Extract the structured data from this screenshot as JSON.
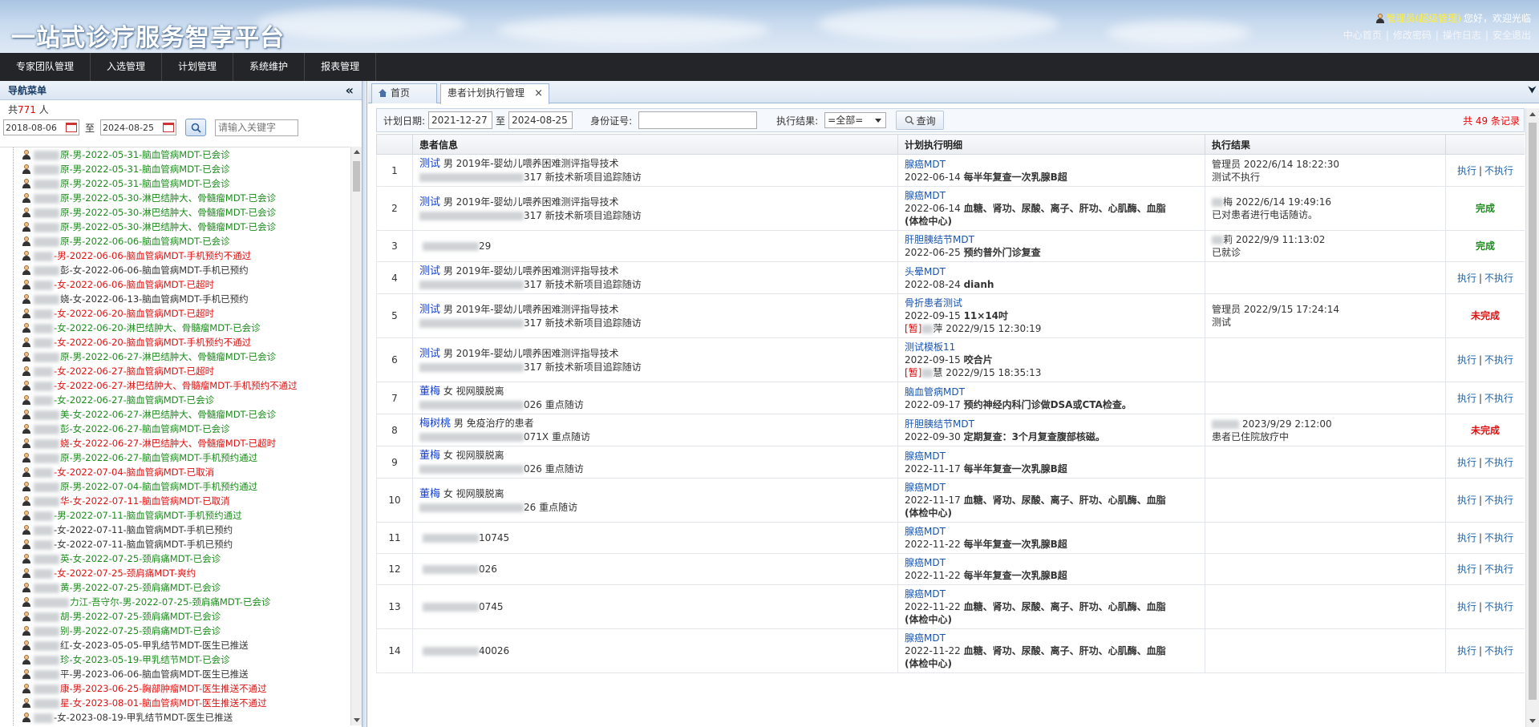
{
  "app": {
    "title": "一站式诊疗服务智享平台",
    "user_role": "管理员(超级管理)",
    "greeting": "您好，欢迎光临",
    "header_links": [
      "中心首页",
      "修改密码",
      "操作日志",
      "安全退出"
    ]
  },
  "topnav": [
    "专家团队管理",
    "入选管理",
    "计划管理",
    "系统维护",
    "报表管理"
  ],
  "sidebar": {
    "title": "导航菜单",
    "collapse_icon": "«",
    "count_prefix": "共",
    "count": "771",
    "count_suffix": "人",
    "date_from": "2018-08-06",
    "date_sep": "至",
    "date_to": "2024-08-25",
    "keyword_placeholder": "请输入关键字",
    "items": [
      {
        "text": "原-男-2022-05-31-脑血管病MDT-已会诊",
        "color": "green",
        "b": "n"
      },
      {
        "text": "原-男-2022-05-31-脑血管病MDT-已会诊",
        "color": "green",
        "b": "n"
      },
      {
        "text": "原-男-2022-05-31-脑血管病MDT-已会诊",
        "color": "green",
        "b": "n"
      },
      {
        "text": "原-男-2022-05-30-淋巴结肿大、骨髓瘤MDT-已会诊",
        "color": "green",
        "b": "n"
      },
      {
        "text": "原-男-2022-05-30-淋巴结肿大、骨髓瘤MDT-已会诊",
        "color": "green",
        "b": "n"
      },
      {
        "text": "原-男-2022-05-30-淋巴结肿大、骨髓瘤MDT-已会诊",
        "color": "green",
        "b": "n"
      },
      {
        "text": "原-男-2022-06-06-脑血管病MDT-已会诊",
        "color": "green",
        "b": "n"
      },
      {
        "text": "-男-2022-06-06-脑血管病MDT-手机预约不通过",
        "color": "red",
        "b": "s"
      },
      {
        "text": "彭-女-2022-06-06-脑血管病MDT-手机已预约",
        "color": "black",
        "b": "n"
      },
      {
        "text": "-女-2022-06-06-脑血管病MDT-已超时",
        "color": "red",
        "b": "s"
      },
      {
        "text": "娆-女-2022-06-13-脑血管病MDT-手机已预约",
        "color": "black",
        "b": "n"
      },
      {
        "text": "-女-2022-06-20-脑血管病MDT-已超时",
        "color": "red",
        "b": "s"
      },
      {
        "text": "-女-2022-06-20-淋巴结肿大、骨髓瘤MDT-已会诊",
        "color": "green",
        "b": "s"
      },
      {
        "text": "-女-2022-06-20-脑血管病MDT-手机预约不通过",
        "color": "red",
        "b": "s"
      },
      {
        "text": "原-男-2022-06-27-淋巴结肿大、骨髓瘤MDT-已会诊",
        "color": "green",
        "b": "n"
      },
      {
        "text": "-女-2022-06-27-脑血管病MDT-已超时",
        "color": "red",
        "b": "s"
      },
      {
        "text": "-女-2022-06-27-淋巴结肿大、骨髓瘤MDT-手机预约不通过",
        "color": "red",
        "b": "s"
      },
      {
        "text": "-女-2022-06-27-脑血管病MDT-已会诊",
        "color": "green",
        "b": "s"
      },
      {
        "text": "美-女-2022-06-27-淋巴结肿大、骨髓瘤MDT-已会诊",
        "color": "green",
        "b": "n"
      },
      {
        "text": "彭-女-2022-06-27-脑血管病MDT-已会诊",
        "color": "green",
        "b": "n"
      },
      {
        "text": "娆-女-2022-06-27-淋巴结肿大、骨髓瘤MDT-已超时",
        "color": "red",
        "b": "n"
      },
      {
        "text": "原-男-2022-06-27-脑血管病MDT-手机预约通过",
        "color": "green",
        "b": "n"
      },
      {
        "text": "-女-2022-07-04-脑血管病MDT-已取消",
        "color": "red",
        "b": "s"
      },
      {
        "text": "原-男-2022-07-04-脑血管病MDT-手机预约通过",
        "color": "green",
        "b": "n"
      },
      {
        "text": "华-女-2022-07-11-脑血管病MDT-已取消",
        "color": "red",
        "b": "n"
      },
      {
        "text": "-男-2022-07-11-脑血管病MDT-手机预约通过",
        "color": "green",
        "b": "s"
      },
      {
        "text": "-女-2022-07-11-脑血管病MDT-手机已预约",
        "color": "black",
        "b": "s"
      },
      {
        "text": "-女-2022-07-11-脑血管病MDT-手机已预约",
        "color": "black",
        "b": "s"
      },
      {
        "text": "英-女-2022-07-25-颈肩痛MDT-已会诊",
        "color": "green",
        "b": "n"
      },
      {
        "text": "-女-2022-07-25-颈肩痛MDT-爽约",
        "color": "red",
        "b": "s"
      },
      {
        "text": "黄-男-2022-07-25-颈肩痛MDT-已会诊",
        "color": "green",
        "b": "n"
      },
      {
        "text": "力江-吾守尔-男-2022-07-25-颈肩痛MDT-已会诊",
        "color": "green",
        "b": "l"
      },
      {
        "text": "胡-男-2022-07-25-颈肩痛MDT-已会诊",
        "color": "green",
        "b": "n"
      },
      {
        "text": "别-男-2022-07-25-颈肩痛MDT-已会诊",
        "color": "green",
        "b": "n"
      },
      {
        "text": "红-女-2023-05-05-甲乳结节MDT-医生已推送",
        "color": "black",
        "b": "n"
      },
      {
        "text": "珍-女-2023-05-19-甲乳结节MDT-已会诊",
        "color": "green",
        "b": "n"
      },
      {
        "text": "平-男-2023-06-06-脑血管病MDT-医生已推送",
        "color": "black",
        "b": "n"
      },
      {
        "text": "康-男-2023-06-25-胸部肿瘤MDT-医生推送不通过",
        "color": "red",
        "b": "n"
      },
      {
        "text": "星-女-2023-08-01-脑血管病MDT-医生推送不通过",
        "color": "red",
        "b": "n"
      },
      {
        "text": "-女-2023-08-19-甲乳结节MDT-医生已推送",
        "color": "black",
        "b": "s"
      }
    ]
  },
  "tabs": {
    "home": "首页",
    "active": "患者计划执行管理",
    "close_icon": "×"
  },
  "filter": {
    "plan_date_label": "计划日期:",
    "date_from": "2021-12-27",
    "date_sep": "至",
    "date_to": "2024-08-25",
    "id_label": "身份证号:",
    "id_value": "",
    "result_label": "执行结果:",
    "result_selected": "=全部=",
    "query_button": "查询",
    "total": "共 49 条记录"
  },
  "table": {
    "headers": [
      "",
      "患者信息",
      "计划执行明细",
      "执行结果",
      ""
    ],
    "action_exec": "执行",
    "action_sep": "|",
    "action_skip": "不执行",
    "rows": [
      {
        "no": "1",
        "name": "测试",
        "info": "男 2019年-婴幼儿喂养困难测评指导技术",
        "id_tail": "317",
        "id_note": "新技术新项目追踪随访",
        "plan_link": "腺癌MDT",
        "plan_date": "2022-06-14",
        "plan_text": "每半年复查一次乳腺B超",
        "plan_extra": "",
        "plan_flag": "",
        "plan_flag_tail": "",
        "result_line1": "管理员 2022/6/14 18:22:30",
        "result_line2": "测试不执行",
        "status": "",
        "has_action": true
      },
      {
        "no": "2",
        "name": "测试",
        "info": "男 2019年-婴幼儿喂养困难测评指导技术",
        "id_tail": "317",
        "id_note": "新技术新项目追踪随访",
        "plan_link": "腺癌MDT",
        "plan_date": "2022-06-14",
        "plan_text": "血糖、肾功、尿酸、离子、肝功、心肌酶、血脂",
        "plan_extra": "(体检中心)",
        "plan_flag": "",
        "plan_flag_tail": "",
        "result_line1": "梅 2022/6/14 19:49:16",
        "result_line2": "已对患者进行电话随访。",
        "status": "完成",
        "has_action": false
      },
      {
        "no": "3",
        "name": "",
        "info": "",
        "id_tail": "29",
        "id_note": "",
        "plan_link": "肝胆胰结节MDT",
        "plan_date": "2022-06-25",
        "plan_text": "预约普外门诊复查",
        "plan_extra": "",
        "plan_flag": "",
        "plan_flag_tail": "",
        "result_line1": "莉 2022/9/9 11:13:02",
        "result_line2": "已就诊",
        "status": "完成",
        "has_action": false
      },
      {
        "no": "4",
        "name": "测试",
        "info": "男 2019年-婴幼儿喂养困难测评指导技术",
        "id_tail": "317",
        "id_note": "新技术新项目追踪随访",
        "plan_link": "头晕MDT",
        "plan_date": "2022-08-24",
        "plan_text": "dianh",
        "plan_extra": "",
        "plan_flag": "",
        "plan_flag_tail": "",
        "result_line1": "",
        "result_line2": "",
        "status": "",
        "has_action": true
      },
      {
        "no": "5",
        "name": "测试",
        "info": "男 2019年-婴幼儿喂养困难测评指导技术",
        "id_tail": "317",
        "id_note": "新技术新项目追踪随访",
        "plan_link": "骨折患者测试",
        "plan_date": "2022-09-15",
        "plan_text": "11×14吋",
        "plan_extra": "",
        "plan_flag": "[暂]",
        "plan_flag_tail": "萍 2022/9/15 12:30:19",
        "result_line1": "管理员 2022/9/15 17:24:14",
        "result_line2": "测试",
        "status": "未完成",
        "has_action": false
      },
      {
        "no": "6",
        "name": "测试",
        "info": "男 2019年-婴幼儿喂养困难测评指导技术",
        "id_tail": "317",
        "id_note": "新技术新项目追踪随访",
        "plan_link": "测试模板11",
        "plan_date": "2022-09-15",
        "plan_text": "咬合片",
        "plan_extra": "",
        "plan_flag": "[暂]",
        "plan_flag_tail": "慧 2022/9/15 18:35:13",
        "result_line1": "",
        "result_line2": "",
        "status": "",
        "has_action": true
      },
      {
        "no": "7",
        "name": "董梅",
        "info": "女 视网膜脱离",
        "id_tail": "026",
        "id_note": "重点随访",
        "plan_link": "脑血管病MDT",
        "plan_date": "2022-09-17",
        "plan_text": "预约神经内科门诊做DSA或CTA检查。",
        "plan_extra": "",
        "plan_flag": "",
        "plan_flag_tail": "",
        "result_line1": "",
        "result_line2": "",
        "status": "",
        "has_action": true
      },
      {
        "no": "8",
        "name": "梅树桃",
        "info": "男 免疫治疗的患者",
        "id_tail": "071X",
        "id_note": "重点随访",
        "plan_link": "肝胆胰结节MDT",
        "plan_date": "2022-09-30",
        "plan_text": "定期复查：3个月复查腹部核磁。",
        "plan_extra": "",
        "plan_flag": "",
        "plan_flag_tail": "",
        "result_line1": "2023/9/29 2:12:00",
        "result_line2": "患者已住院放疗中",
        "status": "未完成",
        "has_action": false
      },
      {
        "no": "9",
        "name": "董梅",
        "info": "女 视网膜脱离",
        "id_tail": "026",
        "id_note": "重点随访",
        "plan_link": "腺癌MDT",
        "plan_date": "2022-11-17",
        "plan_text": "每半年复查一次乳腺B超",
        "plan_extra": "",
        "plan_flag": "",
        "plan_flag_tail": "",
        "result_line1": "",
        "result_line2": "",
        "status": "",
        "has_action": true
      },
      {
        "no": "10",
        "name": "董梅",
        "info": "女 视网膜脱离",
        "id_tail": "26",
        "id_note": "重点随访",
        "plan_link": "腺癌MDT",
        "plan_date": "2022-11-17",
        "plan_text": "血糖、肾功、尿酸、离子、肝功、心肌酶、血脂",
        "plan_extra": "(体检中心)",
        "plan_flag": "",
        "plan_flag_tail": "",
        "result_line1": "",
        "result_line2": "",
        "status": "",
        "has_action": true
      },
      {
        "no": "11",
        "name": "",
        "info": "",
        "id_tail": "10745",
        "id_note": "",
        "plan_link": "腺癌MDT",
        "plan_date": "2022-11-22",
        "plan_text": "每半年复查一次乳腺B超",
        "plan_extra": "",
        "plan_flag": "",
        "plan_flag_tail": "",
        "result_line1": "",
        "result_line2": "",
        "status": "",
        "has_action": true
      },
      {
        "no": "12",
        "name": "",
        "info": "",
        "id_tail": "026",
        "id_note": "",
        "plan_link": "腺癌MDT",
        "plan_date": "2022-11-22",
        "plan_text": "每半年复查一次乳腺B超",
        "plan_extra": "",
        "plan_flag": "",
        "plan_flag_tail": "",
        "result_line1": "",
        "result_line2": "",
        "status": "",
        "has_action": true
      },
      {
        "no": "13",
        "name": "",
        "info": "",
        "id_tail": "0745",
        "id_note": "",
        "plan_link": "腺癌MDT",
        "plan_date": "2022-11-22",
        "plan_text": "血糖、肾功、尿酸、离子、肝功、心肌酶、血脂",
        "plan_extra": "(体检中心)",
        "plan_flag": "",
        "plan_flag_tail": "",
        "result_line1": "",
        "result_line2": "",
        "status": "",
        "has_action": true
      },
      {
        "no": "14",
        "name": "",
        "info": "",
        "id_tail": "40026",
        "id_note": "",
        "plan_link": "腺癌MDT",
        "plan_date": "2022-11-22",
        "plan_text": "血糖、肾功、尿酸、离子、肝功、心肌酶、血脂",
        "plan_extra": "(体检中心)",
        "plan_flag": "",
        "plan_flag_tail": "",
        "result_line1": "",
        "result_line2": "",
        "status": "",
        "has_action": true
      }
    ]
  },
  "icons": {
    "user": "user-icon",
    "calendar": "calendar-icon",
    "search": "search-icon",
    "home": "home-icon",
    "close": "close-icon"
  }
}
